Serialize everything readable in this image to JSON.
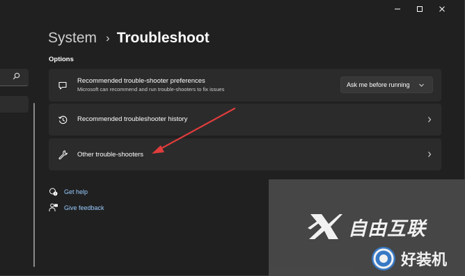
{
  "window": {
    "minimize_icon": "minimize-icon",
    "maximize_icon": "maximize-icon",
    "close_icon": "close-icon"
  },
  "sidebar": {
    "search_icon": "search-icon"
  },
  "header": {
    "breadcrumb_parent": "System",
    "breadcrumb_separator": "›",
    "breadcrumb_current": "Troubleshoot"
  },
  "options": {
    "section_title": "Options",
    "items": [
      {
        "icon": "chat-bubble-icon",
        "title": "Recommended trouble-shooter preferences",
        "subtitle": "Microsoft can recommend and run trouble-shooters to fix issues",
        "dropdown_value": "Ask me before running"
      },
      {
        "icon": "history-icon",
        "title": "Recommended troubleshooter history"
      },
      {
        "icon": "wrench-icon",
        "title": "Other trouble-shooters"
      }
    ]
  },
  "links": [
    {
      "icon": "help-icon",
      "label": "Get help"
    },
    {
      "icon": "feedback-icon",
      "label": "Give feedback"
    }
  ],
  "annotation": {
    "type": "red-arrow",
    "target": "Other trouble-shooters",
    "color": "#e03c3c"
  },
  "watermark": {
    "top_text": "自由互联",
    "bottom_text": "好装机"
  },
  "colors": {
    "background": "#202020",
    "card": "#2b2b2b",
    "link": "#99ccff",
    "arrow": "#e03c3c"
  }
}
